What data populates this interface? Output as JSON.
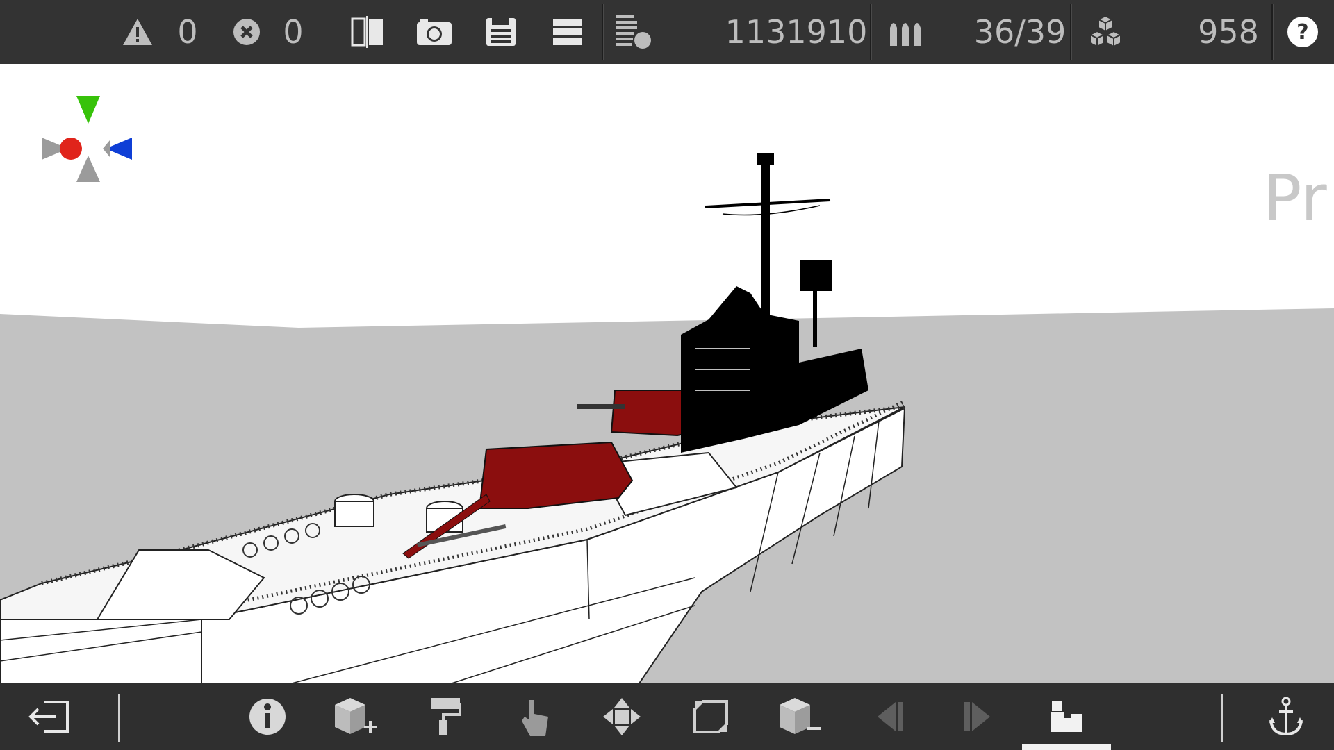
{
  "topbar": {
    "warnings": {
      "icon": "warning-icon",
      "count": "0"
    },
    "errors": {
      "icon": "error-icon",
      "count": "0"
    },
    "tools": [
      "split-view-icon",
      "camera-icon",
      "save-icon",
      "menu-icon",
      "layers-icon"
    ],
    "polygon_count": "1131910",
    "ammo_icon": "ammo-icon",
    "ammo_value": "36/39",
    "parts_icon": "parts-icon",
    "parts_value": "958",
    "help_icon": "help-icon"
  },
  "viewport": {
    "watermark_text": "Pr",
    "axis_gizmo_colors": {
      "y": "#37c20a",
      "x": "#e0241b",
      "z": "#0f3fd6",
      "neutral": "#9b9b9b"
    },
    "colors": {
      "sky": "#ffffff",
      "sea": "#c0c0c0",
      "hull": "#ffffff",
      "turret": "#8b0e0e",
      "superstructure": "#000000"
    }
  },
  "bottombar": {
    "buttons": [
      "exit-icon",
      "info-icon",
      "add-part-icon",
      "paint-icon",
      "select-icon",
      "move-icon",
      "rotate-icon",
      "remove-part-icon",
      "prev-icon",
      "next-icon",
      "build-mode-icon",
      "anchor-icon"
    ],
    "active": "build-mode-icon"
  }
}
